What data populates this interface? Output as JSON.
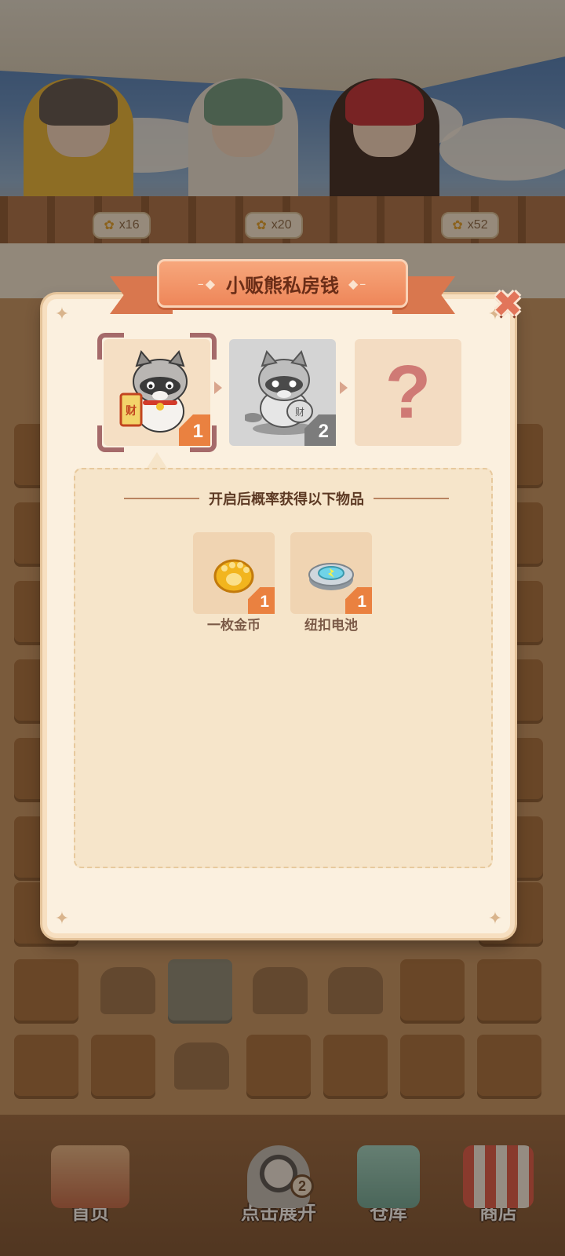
{
  "scene": {
    "characters": [
      {
        "paw_count": "x16"
      },
      {
        "paw_count": "x20"
      },
      {
        "paw_count": "x52"
      }
    ]
  },
  "dialog": {
    "title": "小贩熊私房钱",
    "close_icon": "close-icon",
    "stages": [
      {
        "level": "1",
        "state": "current",
        "icon": "raccoon-lucky-scroll-icon"
      },
      {
        "level": "2",
        "state": "locked-grey",
        "icon": "raccoon-statue-icon"
      },
      {
        "level": "",
        "state": "unknown",
        "text": "?"
      }
    ],
    "rewards_title": "开启后概率获得以下物品",
    "rewards": [
      {
        "name": "一枚金币",
        "count": "1",
        "icon": "gold-paw-coin-icon"
      },
      {
        "name": "纽扣电池",
        "count": "1",
        "icon": "button-battery-icon"
      }
    ]
  },
  "bottom_nav": {
    "items": [
      {
        "label": "首页",
        "icon": "home-town-icon"
      },
      {
        "label": "点击展开",
        "icon": "raccoon-icon",
        "badge": "2"
      },
      {
        "label": "仓库",
        "icon": "warehouse-box-icon"
      },
      {
        "label": "商店",
        "icon": "shop-stall-icon"
      }
    ]
  },
  "colors": {
    "accent_orange": "#ea8140",
    "ribbon": "#ee8659",
    "dialog_bg": "#fbf0df",
    "question": "#cf7a75"
  }
}
